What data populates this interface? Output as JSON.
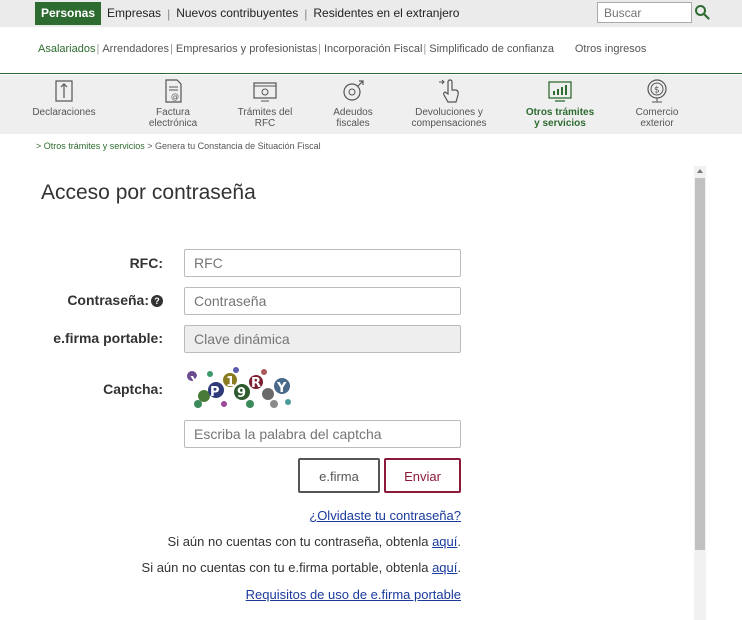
{
  "topbar": {
    "tabs": [
      "Personas",
      "Empresas",
      "Nuevos contribuyentes",
      "Residentes en el extranjero"
    ],
    "search_placeholder": "Buscar"
  },
  "subnav": {
    "items": [
      "Asalariados",
      "Arrendadores",
      "Empresarios y profesionistas",
      "Incorporación Fiscal",
      "Simplificado de confianza",
      "Otros ingresos"
    ]
  },
  "iconnav": {
    "items": [
      {
        "line1": "Declaraciones",
        "line2": "",
        "icon": "declaraciones-icon"
      },
      {
        "line1": "Factura",
        "line2": "electrónica",
        "icon": "factura-icon"
      },
      {
        "line1": "Trámites del",
        "line2": "RFC",
        "icon": "rfc-icon"
      },
      {
        "line1": "Adeudos",
        "line2": "fiscales",
        "icon": "adeudos-icon"
      },
      {
        "line1": "Devoluciones y",
        "line2": "compensaciones",
        "icon": "devoluciones-icon"
      },
      {
        "line1": "Otros trámites",
        "line2": "y servicios",
        "icon": "otros-tramites-icon"
      },
      {
        "line1": "Comercio",
        "line2": "exterior",
        "icon": "comercio-exterior-icon"
      }
    ]
  },
  "breadcrumb": {
    "link": "> Otros trámites y servicios",
    "current": "> Genera tu Constancia de Situación Fiscal"
  },
  "form": {
    "title": "Acceso por contraseña",
    "rfc_label": "RFC:",
    "rfc_placeholder": "RFC",
    "password_label": "Contraseña:",
    "password_placeholder": "Contraseña",
    "efirma_label": "e.firma portable:",
    "efirma_placeholder": "Clave dinámica",
    "captcha_label": "Captcha:",
    "captcha_text": "XP19RY",
    "captcha_placeholder": "Escriba la palabra del captcha",
    "btn_efirma": "e.firma",
    "btn_enviar": "Enviar"
  },
  "links": {
    "forgot": "¿Olvidaste tu contraseña?",
    "no_password_text": "Si aún no cuentas con tu contraseña, obtenla ",
    "no_password_link": "aquí",
    "no_efirma_text": "Si aún no cuentas con tu e.firma portable, obtenla ",
    "no_efirma_link": "aquí",
    "period": ".",
    "requisitos": "Requisitos de uso de e.firma portable"
  },
  "colors": {
    "brand_green": "#2e6b30",
    "enviar_border": "#8b1a3a",
    "link_blue": "#1a3b9c"
  }
}
